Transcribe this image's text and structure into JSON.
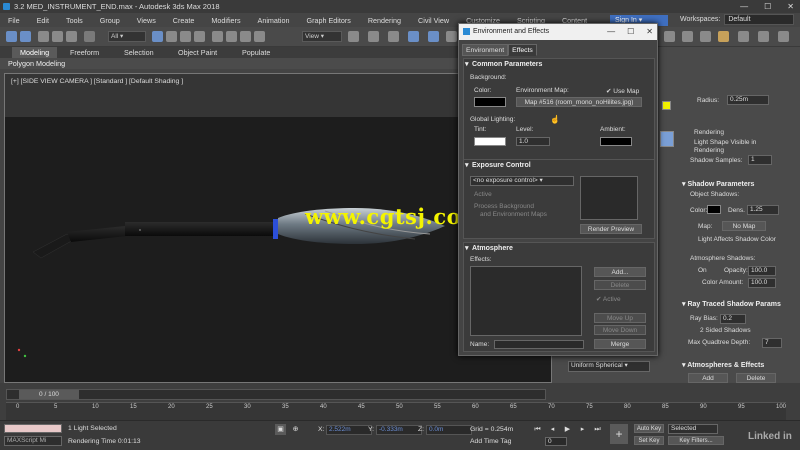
{
  "window": {
    "title": "3.2 MED_INSTRUMENT_END.max - Autodesk 3ds Max 2018",
    "controls": [
      "—",
      "☐",
      "✕"
    ]
  },
  "menu": {
    "items": [
      "File",
      "Edit",
      "Tools",
      "Group",
      "Views",
      "Create",
      "Modifiers",
      "Animation",
      "Graph Editors",
      "Rendering",
      "Civil View",
      "Customize",
      "Scripting",
      "Content"
    ],
    "sign_in": "Sign In",
    "workspaces_label": "Workspaces:",
    "workspaces_value": "Default"
  },
  "toolbar": {
    "selection_filter": "All",
    "ref_coord": "View"
  },
  "ribbon": {
    "tabs": [
      "Modeling",
      "Freeform",
      "Selection",
      "Object Paint",
      "Populate"
    ],
    "active": "Modeling",
    "subpanel": "Polygon Modeling"
  },
  "viewport": {
    "label": "[+] [SIDE VIEW CAMERA ] [Standard ] [Default Shading ]",
    "watermark": "www.cgtsj.com"
  },
  "dialog": {
    "title": "Environment and Effects",
    "controls": [
      "—",
      "☐",
      "✕"
    ],
    "tabs": [
      "Environment",
      "Effects"
    ],
    "common": {
      "heading": "Common Parameters",
      "background_label": "Background:",
      "color_label": "Color:",
      "env_map_label": "Environment Map:",
      "use_map_label": "Use Map",
      "use_map_check": "✔",
      "map_button": "Map #516 (room_mono_noHilites.jpg)",
      "global_lighting": "Global Lighting:",
      "tint_label": "Tint:",
      "level_label": "Level:",
      "level_value": "1.0",
      "ambient_label": "Ambient:"
    },
    "exposure": {
      "heading": "Exposure Control",
      "dropdown": "<no exposure control>",
      "active": "Active",
      "process_bg": "Process Background",
      "and_env": "and Environment Maps",
      "render_preview": "Render Preview"
    },
    "atmosphere": {
      "heading": "Atmosphere",
      "effects_label": "Effects:",
      "add": "Add...",
      "delete": "Delete",
      "active": "Active",
      "move_up": "Move Up",
      "move_down": "Move Down",
      "name_label": "Name:",
      "merge": "Merge"
    }
  },
  "right_panel": {
    "radius_label": "Radius:",
    "radius_value": "0.25m",
    "rendering_label": "Rendering",
    "light_shape_visible": "Light Shape Visible in Rendering",
    "shadow_samples_label": "Shadow Samples:",
    "shadow_samples_value": "1",
    "shadow_params": "Shadow Parameters",
    "object_shadows": "Object Shadows:",
    "color_label": "Color:",
    "dens_label": "Dens.",
    "dens_value": "1.25",
    "map_label": "Map:",
    "no_map": "No Map",
    "light_affects": "Light Affects Shadow Color",
    "atmo_shadows": "Atmosphere Shadows:",
    "on_label": "On",
    "opacity_label": "Opacity:",
    "opacity_value": "100.0",
    "color_amount_label": "Color Amount:",
    "color_amount_value": "100.0",
    "uniform_spherical": "Uniform Spherical",
    "ray_traced": "Ray Traced Shadow Params",
    "ray_bias_label": "Ray Bias:",
    "ray_bias_value": "0.2",
    "two_sided": "2 Sided Shadows",
    "max_quadtree_label": "Max Quadtree Depth:",
    "max_quadtree_value": "7",
    "atmospheres_effects": "Atmospheres & Effects",
    "add": "Add",
    "delete": "Delete"
  },
  "timeline": {
    "slider": "0 / 100",
    "ticks": [
      "0",
      "5",
      "10",
      "15",
      "20",
      "25",
      "30",
      "35",
      "40",
      "45",
      "50",
      "55",
      "60",
      "65",
      "70",
      "75",
      "80",
      "85",
      "90",
      "95",
      "100"
    ]
  },
  "status": {
    "maxscript": "MAXScript Mi",
    "selection": "1 Light Selected",
    "render_time": "Rendering Time  0:01:13",
    "x_label": "X:",
    "x_value": "2.522m",
    "y_label": "Y:",
    "y_value": "-0.333m",
    "z_label": "Z:",
    "z_value": "0.0m",
    "grid": "Grid = 0.254m",
    "add_time_tag": "Add Time Tag",
    "auto_key": "Auto Key",
    "set_key": "Set Key",
    "selected": "Selected",
    "key_filters": "Key Filters...",
    "frame_value": "0",
    "brand": "Linked in"
  }
}
